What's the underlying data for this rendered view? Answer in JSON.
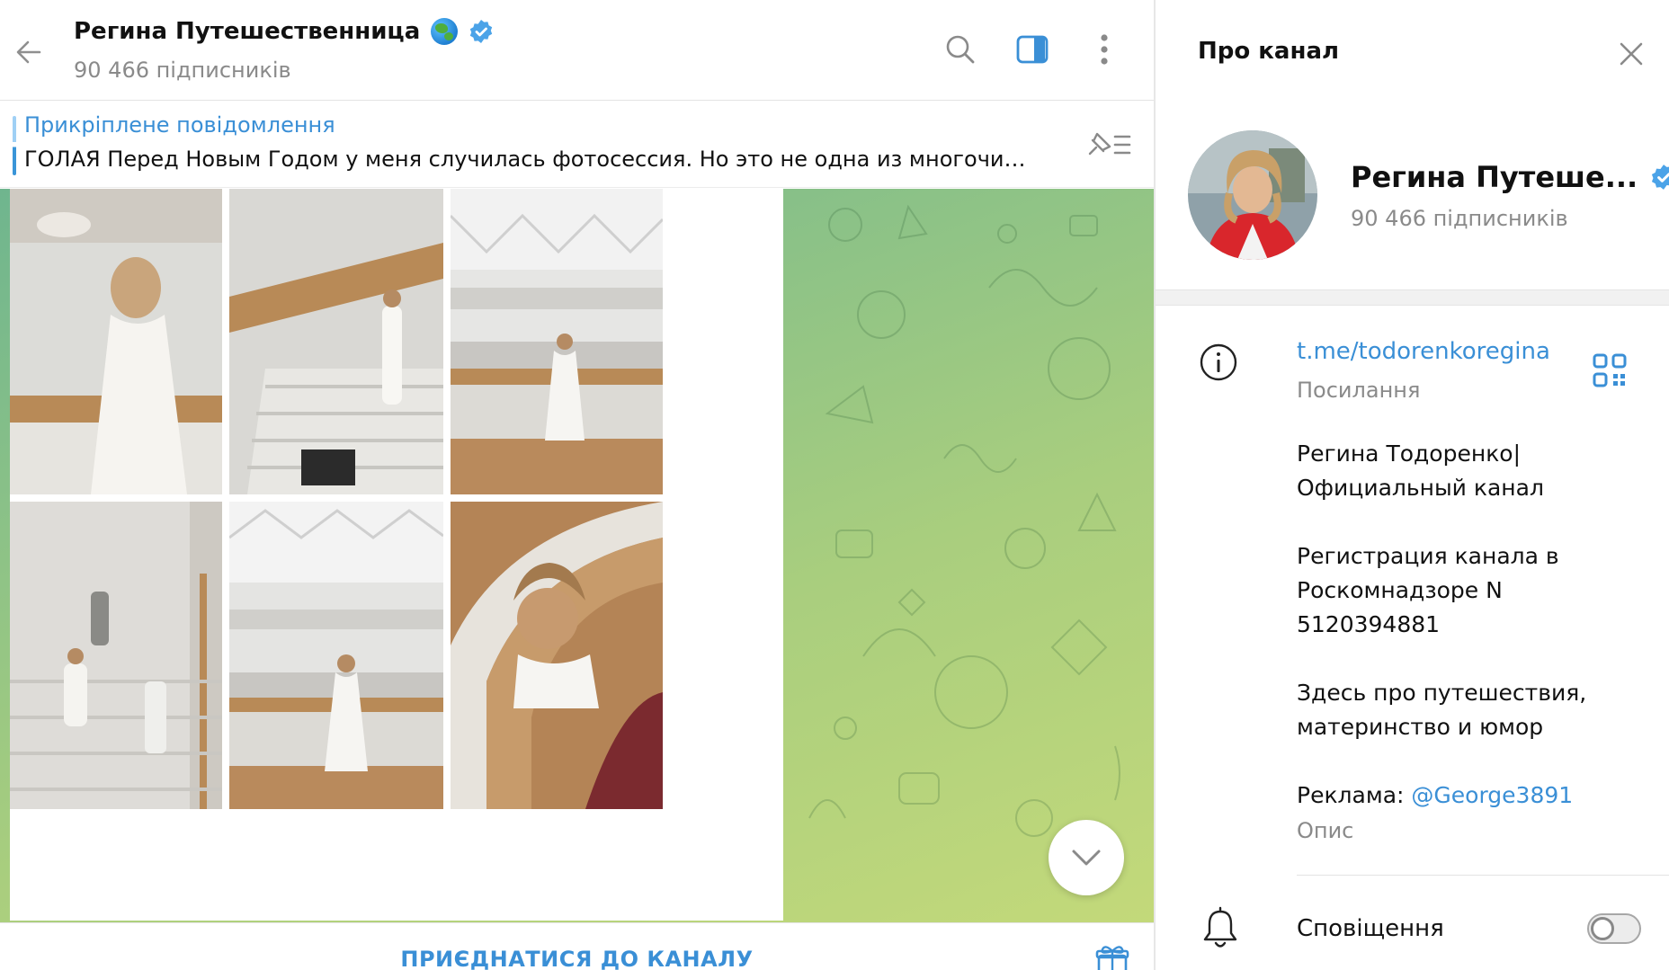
{
  "header": {
    "title": "Регина Путешественница",
    "subscribers": "90 466 підписників",
    "verified_icon": "verified-badge-icon",
    "globe_icon": "globe-emoji-icon"
  },
  "pinned": {
    "title": "Прикріплене повідомлення",
    "text": "ГОЛАЯ  Перед Новым Годом у меня случилась фотосессия. Но это не одна из многочисл…"
  },
  "bottom": {
    "join_label": "ПРИЄДНАТИСЯ ДО КАНАЛУ"
  },
  "panel": {
    "title": "Про канал",
    "name": "Регина Путеше...",
    "subscribers": "90 466 підписників",
    "link": "t.me/todorenkoregina",
    "link_label": "Посилання",
    "description_lines": [
      "Регина Тодоренко|",
      "Официальный канал",
      "Регистрация канала в",
      "Роскомнадзоре N",
      "5120394881",
      "Здесь про путешествия,",
      "материнство и юмор"
    ],
    "ad_prefix": "Реклама: ",
    "ad_mention": "@George3891",
    "description_label": "Опис",
    "notifications_label": "Сповіщення",
    "notifications_on": false
  },
  "colors": {
    "accent": "#3a8fd6",
    "muted": "#8a8a8a",
    "verified": "#4ba3e8"
  }
}
